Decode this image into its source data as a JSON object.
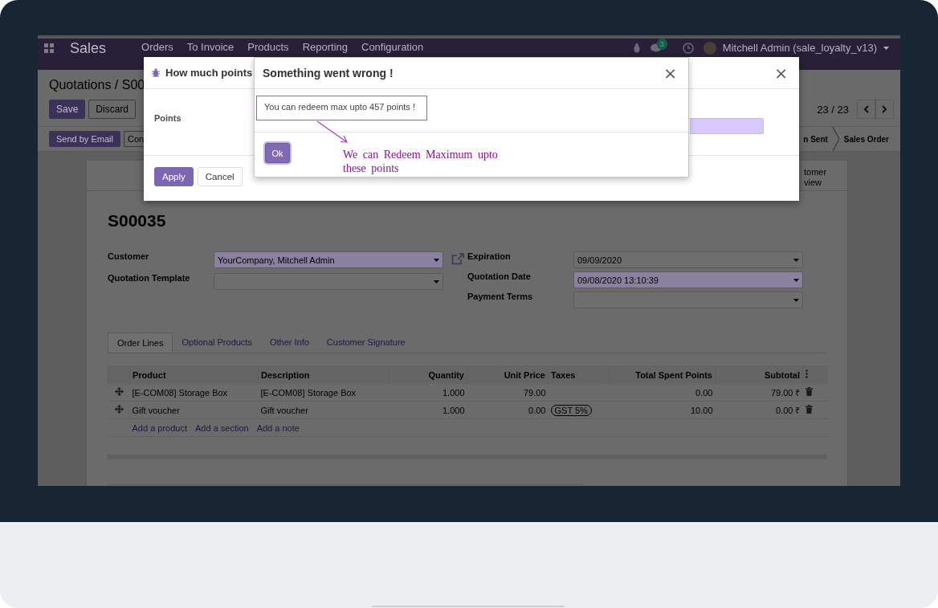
{
  "navbar": {
    "app_name": "Sales",
    "menu": [
      "Orders",
      "To Invoice",
      "Products",
      "Reporting",
      "Configuration"
    ],
    "message_count": "3",
    "user": "Mitchell Admin (sale_loyalty_v13)"
  },
  "control_panel": {
    "breadcrumb": "Quotations / S00",
    "buttons": [
      {
        "label": "Save",
        "kind": "primary"
      },
      {
        "label": "Discard",
        "kind": "secondary"
      }
    ],
    "pager": "23 / 23"
  },
  "status_bar": {
    "buttons": [
      {
        "label": "Send by Email",
        "kind": "primary"
      },
      {
        "label": "Con",
        "kind": "secondary"
      }
    ],
    "stages": [
      "n Sent",
      "Sales Order"
    ]
  },
  "sheet": {
    "button_box": [
      "tomer",
      "view"
    ],
    "name": "S00035",
    "left_fields": [
      {
        "label": "Customer",
        "value": "YourCompany, Mitchell Admin",
        "required": true
      },
      {
        "label": "Quotation Template",
        "required": false
      }
    ],
    "right_fields": [
      {
        "label": "Expiration",
        "value": "09/09/2020",
        "required": false
      },
      {
        "label": "Quotation Date",
        "value": "09/08/2020 13:10:39",
        "required": true
      },
      {
        "label": "Payment Terms",
        "required": false
      }
    ],
    "tabs": [
      {
        "label": "Order Lines",
        "selected": true
      },
      {
        "label": "Optional Products",
        "selected": false
      },
      {
        "label": "Other Info",
        "selected": false
      },
      {
        "label": "Customer Signature",
        "selected": false
      }
    ],
    "table": {
      "columns": [
        "Product",
        "Description",
        "Quantity",
        "Unit Price",
        "Taxes",
        "Total Spent Points",
        "Subtotal"
      ],
      "rows": [
        {
          "product": "[E-COM08] Storage Box",
          "description": "[E-COM08] Storage Box",
          "quantity": "1.000",
          "unit_price": "79.00",
          "spent_points": "0.00",
          "subtotal": "79.00 ₹"
        },
        {
          "product": "Gift voucher",
          "description": "Gift voucher",
          "quantity": "1.000",
          "unit_price": "0.00",
          "taxes": [
            "GST 5%"
          ],
          "spent_points": "10.00",
          "subtotal": "0.00 ₹"
        }
      ],
      "add_links": [
        "Add a product",
        "Add a section",
        "Add a note"
      ]
    }
  },
  "points_dialog": {
    "title": "How much points",
    "close": "×",
    "field_label": "Points",
    "buttons": [
      {
        "label": "Apply",
        "kind": "primary"
      },
      {
        "label": "Cancel",
        "kind": "secondary"
      }
    ]
  },
  "error_dialog": {
    "title": "Something went wrong !",
    "close": "×",
    "message": "You can redeem max upto 457 points !",
    "button": "Ok",
    "annotation": "We can Redeem Maximum upto these points"
  }
}
